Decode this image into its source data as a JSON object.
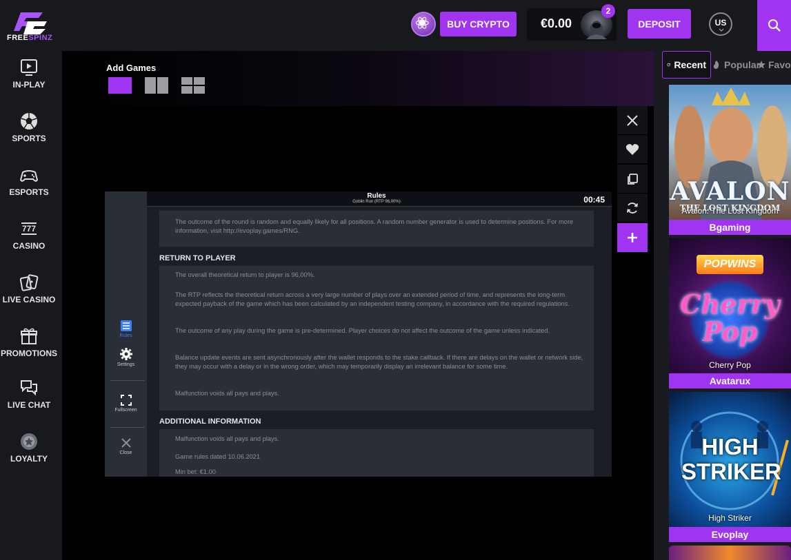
{
  "brand": {
    "name_bold": "FREE",
    "name_accent": "SPINZ"
  },
  "header": {
    "buy_crypto": "BUY CRYPTO",
    "balance": "€0.00",
    "notifications": "2",
    "deposit": "DEPOSIT",
    "language": "US"
  },
  "sidebar": {
    "items": [
      {
        "label": "IN-PLAY",
        "icon": "play-screen-icon"
      },
      {
        "label": "SPORTS",
        "icon": "soccer-ball-icon"
      },
      {
        "label": "ESPORTS",
        "icon": "gamepad-icon"
      },
      {
        "label": "CASINO",
        "icon": "slot-777-icon"
      },
      {
        "label": "LIVE CASINO",
        "icon": "cards-icon"
      },
      {
        "label": "PROMOTIONS",
        "icon": "gift-icon"
      },
      {
        "label": "LIVE CHAT",
        "icon": "chat-icon"
      },
      {
        "label": "LOYALTY",
        "icon": "loyalty-badge-icon"
      }
    ]
  },
  "game_area": {
    "add_games_label": "Add Games",
    "rules_panel": {
      "title": "Rules",
      "subtitle": "Goblin Run (RTP 96,00%)",
      "timer": "00:45",
      "intro_text": "The outcome of the round is random and equally likely for all positions. A random number generator is used to determine positions. For more information, visit http://evoplay.games/RNG.",
      "section_rtp": "RETURN TO PLAYER",
      "rtp_paragraphs": [
        "The overall theoretical return to player is 96,00%.",
        "The RTP reflects the theoretical return across a very large number of plays over an extended period of time, and represents the long-term expected payback of the game which has been calculated by an independent testing company, in accordance with the required regulations.",
        "The outcome of any play during the game is pre-determined. Player choices do not affect the outcome of the game unless indicated.",
        "Balance update events are sent asynchronously after the wallet responds to the stake callback. If there are delays on the wallet or network side, they may occur with a delay or in the wrong order, which may temporarily display an irrelevant balance for some time.",
        "Malfunction voids all pays and plays."
      ],
      "section_additional": "ADDITIONAL INFORMATION",
      "additional_lines": [
        "Malfunction voids all pays and plays.",
        "Game rules dated 10.06.2021",
        "Min bet: €1.00"
      ],
      "tools": {
        "rules": "Rules",
        "settings": "Settings",
        "fullscreen": "Fullscreen",
        "close": "Close"
      }
    }
  },
  "right_panel": {
    "tabs": [
      "Recent",
      "Popular",
      "Favo"
    ],
    "games": [
      {
        "thumb_title": "AVALON",
        "thumb_sub": "THE LOST KINGDOM",
        "thumb_name": "Avalon: The Lost Kingdom",
        "provider": "Bgaming"
      },
      {
        "thumb_title": "Cherry Pop",
        "thumb_brand": "POPWINS",
        "thumb_name": "Cherry Pop",
        "provider": "Avatarux"
      },
      {
        "thumb_title": "HIGH STRIKER",
        "thumb_name": "High Striker",
        "provider": "Evoplay"
      }
    ]
  },
  "colors": {
    "accent": "#a034f0",
    "background": "#15161a",
    "panel": "#1b1e25"
  }
}
